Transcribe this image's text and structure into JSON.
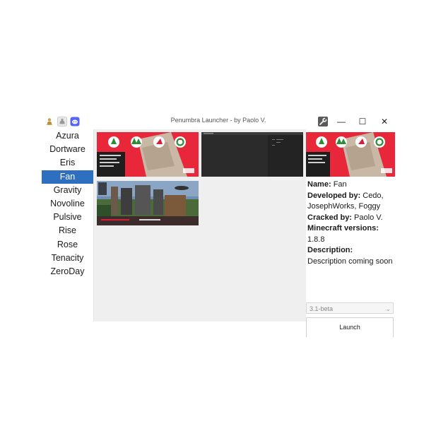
{
  "window": {
    "title": "Penumbra Launcher - by Paolo V.",
    "toolbar_icons": [
      "person-icon",
      "money-bag-icon",
      "discord-icon"
    ],
    "controls": {
      "settings_icon": "wrench-icon",
      "minimize": "—",
      "maximize": "☐",
      "close": "✕"
    }
  },
  "sidebar": {
    "items": [
      "Azura",
      "Dortware",
      "Eris",
      "Fan",
      "Gravity",
      "Novoline",
      "Pulsive",
      "Rise",
      "Rose",
      "Tenacity",
      "ZeroDay"
    ],
    "selected": "Fan"
  },
  "gallery": {
    "thumbnails": [
      "fan-christmas-menu-screenshot",
      "dark-code-editor-screenshot",
      "minecraft-ingame-screenshot"
    ]
  },
  "details": {
    "name_label": "Name:",
    "name_value": "Fan",
    "developed_label": "Developed by:",
    "developed_value_1": "Cedo,",
    "developed_value_2": "JosephWorks, Foggy",
    "cracked_label": "Cracked by:",
    "cracked_value": "Paolo V.",
    "versions_label": "Minecraft versions:",
    "versions_value": "1.8.8",
    "description_label": "Description:",
    "description_value": "Description coming soon"
  },
  "version_select": {
    "value": "3.1-beta"
  },
  "launch_label": "Launch",
  "colors": {
    "selected": "#2f6fbf",
    "thumb_red": "#e8273b",
    "gallery_bg": "#efefef"
  }
}
